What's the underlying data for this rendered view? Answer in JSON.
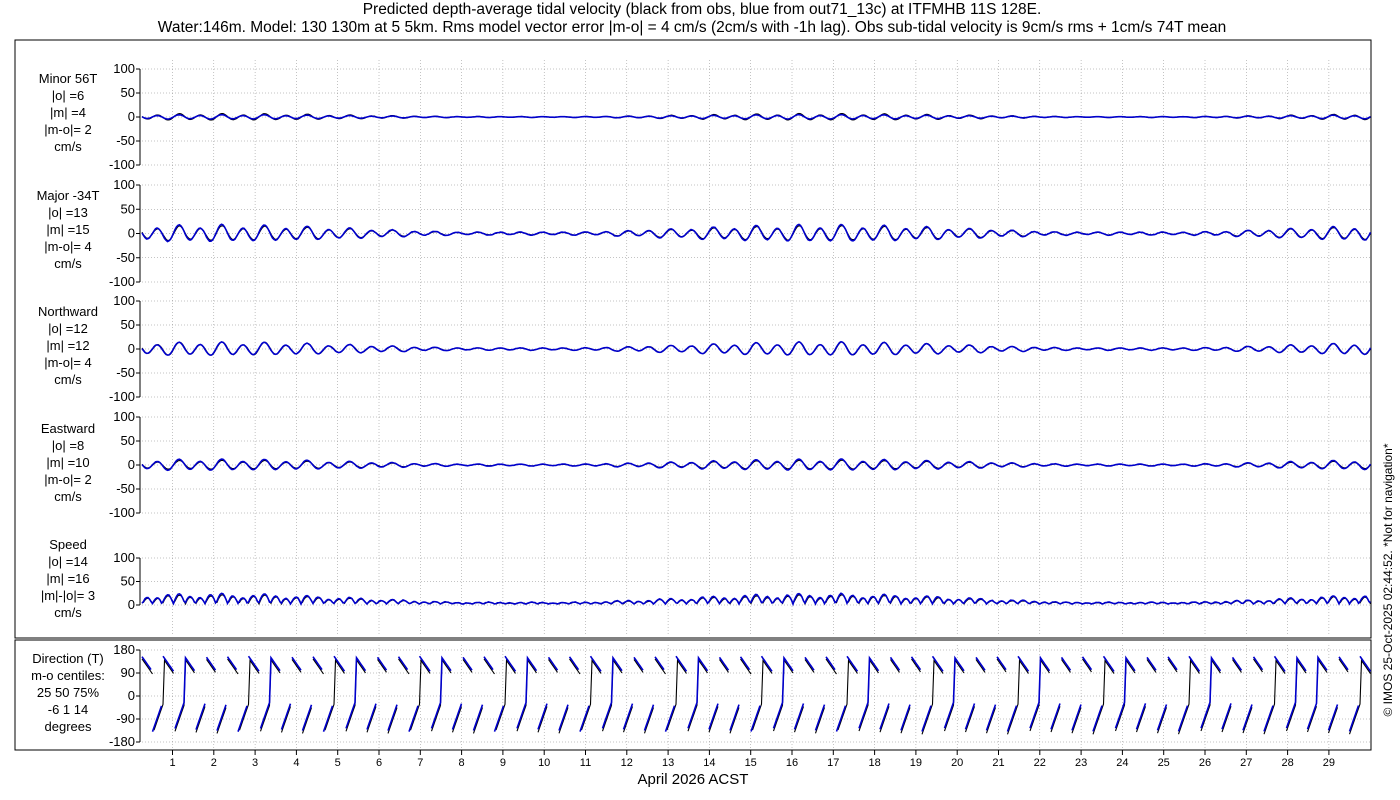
{
  "title": {
    "line1": "Predicted depth-average tidal velocity (black from obs, blue from out71_13c) at ITFMHB 11S 128E.",
    "line2": "Water:146m. Model: 130 130m at 5 5km. Rms model vector error |m-o| = 4 cm/s (2cm/s with -1h lag). Obs sub-tidal velocity is 9cm/s rms + 1cm/s 74T mean"
  },
  "credit": "© IMOS 25-Oct-2025 02:44:52. *Not for navigation*",
  "xaxis": {
    "label": "April 2026 ACST",
    "ticks": [
      "1",
      "2",
      "3",
      "4",
      "5",
      "6",
      "7",
      "8",
      "9",
      "10",
      "11",
      "12",
      "13",
      "14",
      "15",
      "16",
      "17",
      "18",
      "19",
      "20",
      "21",
      "22",
      "23",
      "24",
      "25",
      "26",
      "27",
      "28",
      "29"
    ]
  },
  "colors": {
    "obs": "#000000",
    "model": "#0000cc",
    "grid": "#888888"
  },
  "chart_data": [
    {
      "type": "line",
      "panel": "minor",
      "label_lines": [
        "Minor 56T",
        "|o| =6",
        "|m| =4",
        "|m-o|= 2",
        "cm/s"
      ],
      "ylim": [
        -100,
        100
      ],
      "yticks": [
        "100",
        "50",
        "0",
        "-50",
        "-100"
      ],
      "series": [
        {
          "name": "obs",
          "amplitude_cm_s": 6
        },
        {
          "name": "model",
          "amplitude_cm_s": 4
        }
      ]
    },
    {
      "type": "line",
      "panel": "major",
      "label_lines": [
        "Major -34T",
        "|o| =13",
        "|m| =15",
        "|m-o|= 4",
        "cm/s"
      ],
      "ylim": [
        -100,
        100
      ],
      "yticks": [
        "100",
        "50",
        "0",
        "-50",
        "-100"
      ],
      "series": [
        {
          "name": "obs",
          "amplitude_cm_s": 13
        },
        {
          "name": "model",
          "amplitude_cm_s": 15
        }
      ]
    },
    {
      "type": "line",
      "panel": "northward",
      "label_lines": [
        "Northward",
        "|o| =12",
        "|m| =12",
        "|m-o|= 4",
        "cm/s"
      ],
      "ylim": [
        -100,
        100
      ],
      "yticks": [
        "100",
        "50",
        "0",
        "-50",
        "-100"
      ],
      "series": [
        {
          "name": "obs",
          "amplitude_cm_s": 12
        },
        {
          "name": "model",
          "amplitude_cm_s": 12
        }
      ]
    },
    {
      "type": "line",
      "panel": "eastward",
      "label_lines": [
        "Eastward",
        "|o| =8",
        "|m| =10",
        "|m-o|= 2",
        "cm/s"
      ],
      "ylim": [
        -100,
        100
      ],
      "yticks": [
        "100",
        "50",
        "0",
        "-50",
        "-100"
      ],
      "series": [
        {
          "name": "obs",
          "amplitude_cm_s": 8
        },
        {
          "name": "model",
          "amplitude_cm_s": 10
        }
      ]
    },
    {
      "type": "line",
      "panel": "speed",
      "label_lines": [
        "Speed",
        "|o| =14",
        "|m| =16",
        "|m|-|o|= 3",
        "cm/s"
      ],
      "ylim": [
        0,
        100
      ],
      "yticks": [
        "100",
        "50",
        "0"
      ],
      "series": [
        {
          "name": "obs",
          "amplitude_cm_s": 14
        },
        {
          "name": "model",
          "amplitude_cm_s": 16
        }
      ]
    },
    {
      "type": "line",
      "panel": "direction",
      "label_lines": [
        "Direction (T)",
        "m-o centiles:",
        "25  50  75%",
        "-6   1  14",
        "degrees"
      ],
      "ylim": [
        -180,
        180
      ],
      "yticks": [
        "180",
        "90",
        "0",
        "-90",
        "-180"
      ],
      "series": [
        {
          "name": "obs"
        },
        {
          "name": "model"
        }
      ]
    }
  ]
}
